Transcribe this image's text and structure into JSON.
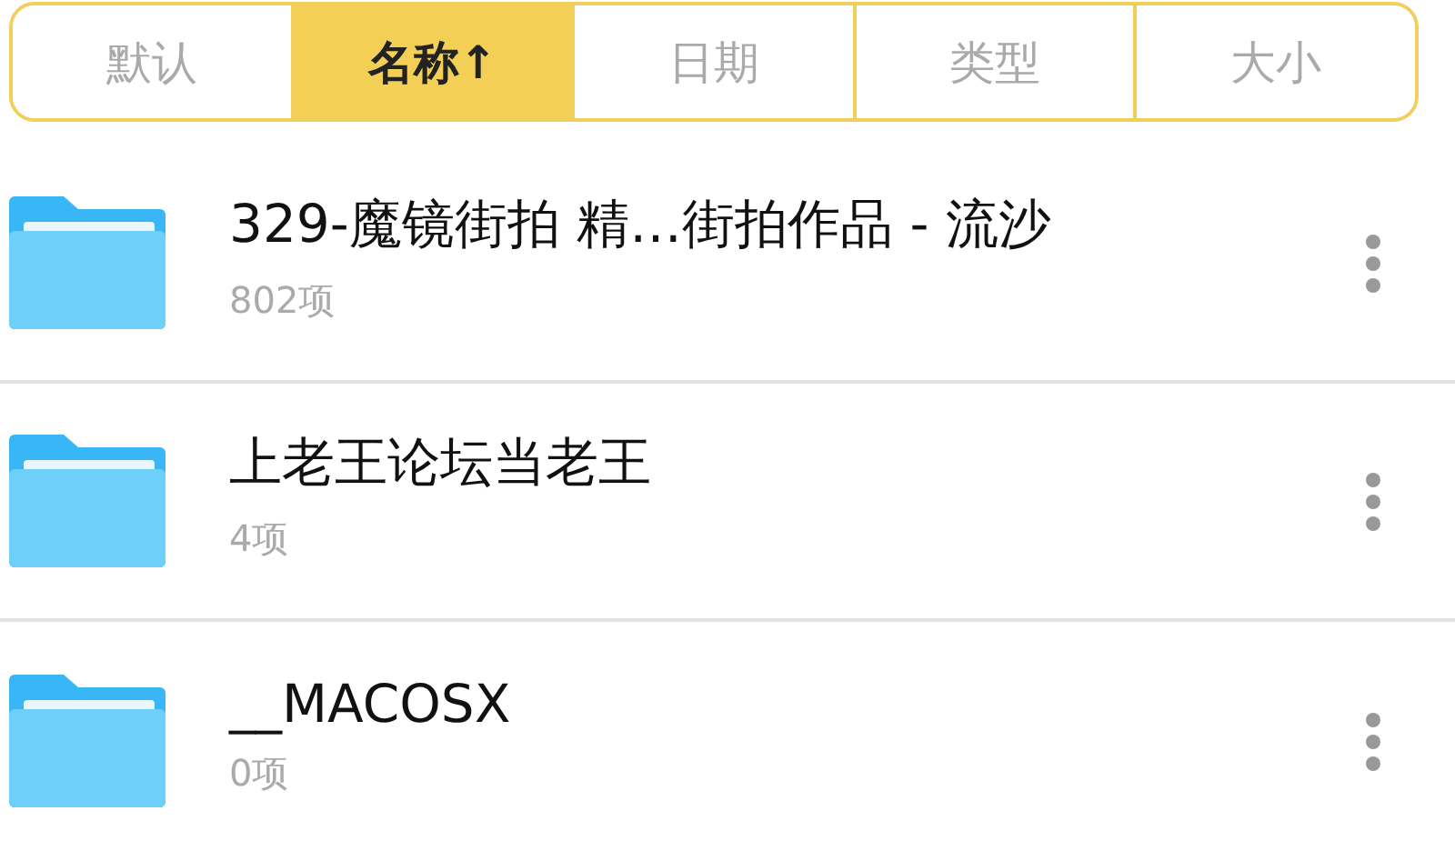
{
  "sort_tabs": [
    {
      "label": "默认",
      "selected": false
    },
    {
      "label": "名称↑",
      "selected": true
    },
    {
      "label": "日期",
      "selected": false
    },
    {
      "label": "类型",
      "selected": false
    },
    {
      "label": "大小",
      "selected": false
    }
  ],
  "files": [
    {
      "name": "329-魔镜街拍 精…街拍作品 - 流沙",
      "count": "802项"
    },
    {
      "name": "上老王论坛当老王",
      "count": "4项"
    },
    {
      "name": "__MACOSX",
      "count": "0项"
    }
  ]
}
